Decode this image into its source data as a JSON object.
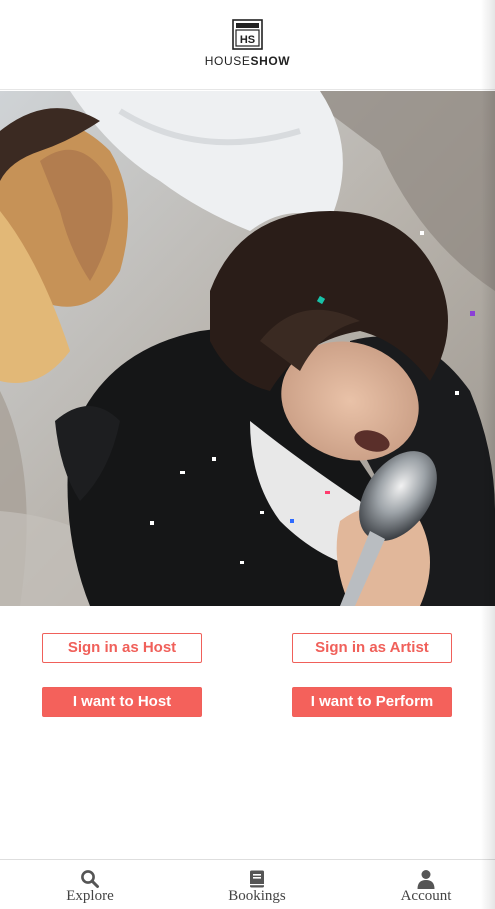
{
  "header": {
    "logo_mark_text": "HS",
    "logo_word_light": "HOUSE",
    "logo_word_bold": "SHOW"
  },
  "actions": {
    "sign_in_host": "Sign in as Host",
    "sign_in_artist": "Sign in as Artist",
    "want_to_host": "I want to Host",
    "want_to_perform": "I want to Perform"
  },
  "nav": {
    "items": [
      {
        "label": "Explore",
        "icon": "search-icon"
      },
      {
        "label": "Bookings",
        "icon": "book-icon"
      },
      {
        "label": "Account",
        "icon": "user-icon"
      }
    ]
  },
  "colors": {
    "accent": "#f4615b",
    "nav_icon": "#555555"
  }
}
